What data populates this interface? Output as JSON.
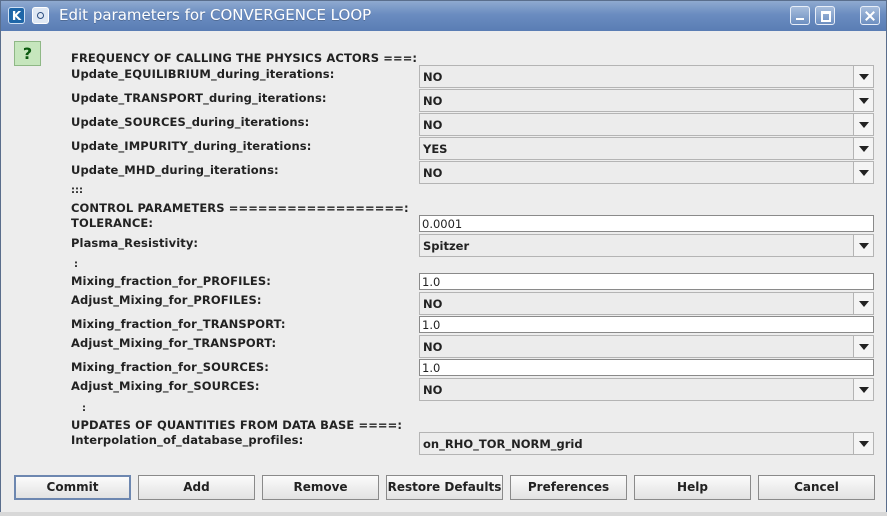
{
  "window": {
    "title": "Edit parameters for CONVERGENCE LOOP",
    "app_icon": "K",
    "colors": {
      "titlebar": "#6a8cc0",
      "background": "#ededed",
      "help_bg": "#c6e6bd"
    }
  },
  "help_icon_label": "?",
  "sections": {
    "frequency_header": "FREQUENCY OF CALLING THE PHYSICS ACTORS  ===:",
    "sep1": ":::",
    "control_header": "CONTROL PARAMETERS ==================:",
    "sep2": ":",
    "sep3": ":",
    "updates_header": "UPDATES OF QUANTITIES FROM DATA BASE ====:"
  },
  "params": {
    "update_equilibrium": {
      "label": "Update_EQUILIBRIUM_during_iterations:",
      "value": "NO"
    },
    "update_transport": {
      "label": "Update_TRANSPORT_during_iterations:",
      "value": "NO"
    },
    "update_sources": {
      "label": "Update_SOURCES_during_iterations:",
      "value": "NO"
    },
    "update_impurity": {
      "label": "Update_IMPURITY_during_iterations:",
      "value": "YES"
    },
    "update_mhd": {
      "label": "Update_MHD_during_iterations:",
      "value": "NO"
    },
    "tolerance": {
      "label": "TOLERANCE:",
      "value": "0.0001"
    },
    "plasma_resistivity": {
      "label": "Plasma_Resistivity:",
      "value": "Spitzer"
    },
    "mixing_profiles": {
      "label": "Mixing_fraction_for_PROFILES:",
      "value": "1.0"
    },
    "adjust_profiles": {
      "label": "Adjust_Mixing_for_PROFILES:",
      "value": "NO"
    },
    "mixing_transport": {
      "label": "Mixing_fraction_for_TRANSPORT:",
      "value": "1.0"
    },
    "adjust_transport": {
      "label": "Adjust_Mixing_for_TRANSPORT:",
      "value": "NO"
    },
    "mixing_sources": {
      "label": "Mixing_fraction_for_SOURCES:",
      "value": "1.0"
    },
    "adjust_sources": {
      "label": "Adjust_Mixing_for_SOURCES:",
      "value": "NO"
    },
    "interpolation": {
      "label": "Interpolation_of_database_profiles:",
      "value": "on_RHO_TOR_NORM_grid"
    }
  },
  "buttons": {
    "commit": "Commit",
    "add": "Add",
    "remove": "Remove",
    "restore_defaults": "Restore Defaults",
    "preferences": "Preferences",
    "help": "Help",
    "cancel": "Cancel"
  }
}
